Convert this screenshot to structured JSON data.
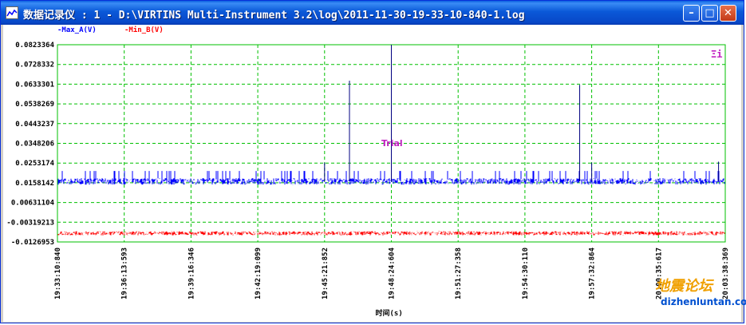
{
  "window": {
    "title": "数据记录仪 : 1 - D:\\VIRTINS Multi-Instrument 3.2\\log\\2011-11-30-19-33-10-840-1.log",
    "minimize_glyph": "–",
    "maximize_glyph": "□",
    "close_glyph": "✕"
  },
  "legend": {
    "a": "-Max_A(V)",
    "b": "-Min_B(V)"
  },
  "badge": "Ξi",
  "annotation": "Trial",
  "watermark": {
    "logo": "地震论坛",
    "url": "dizhenluntan.com"
  },
  "colors": {
    "series_a": "#0000ff",
    "series_b": "#ff0000",
    "grid": "#00c000",
    "frame": "#00c000",
    "title_bar": "#0a58d8"
  },
  "chart_data": {
    "type": "line",
    "title": "",
    "xlabel": "时间(s)",
    "ylabel": "",
    "y_ticks": [
      "0.0823364",
      "0.0728332",
      "0.0633301",
      "0.0538269",
      "0.0443237",
      "0.0348206",
      "0.0253174",
      "0.0158142",
      "0.00631104",
      "-0.00319213",
      "-0.0126953"
    ],
    "ylim": [
      -0.0126953,
      0.0823364
    ],
    "x_ticks": [
      "19:33:10:840",
      "19:36:13:593",
      "19:39:16:346",
      "19:42:19:099",
      "19:45:21:852",
      "19:48:24:604",
      "19:51:27:358",
      "19:54:30:110",
      "19:57:32:864",
      "20:00:35:617",
      "20:03:38:369"
    ],
    "grid": true,
    "series": [
      {
        "name": "Max_A(V)",
        "color": "#0000ff",
        "baseline": 0.0165,
        "noise_band": [
          0.0145,
          0.0215
        ],
        "spikes": [
          {
            "x": "19:45:21:852",
            "y": 0.0255
          },
          {
            "x": "19:46:30:000",
            "y": 0.065
          },
          {
            "x": "19:48:24:604",
            "y": 0.0823
          },
          {
            "x": "19:57:00:000",
            "y": 0.063
          },
          {
            "x": "19:57:32:864",
            "y": 0.0255
          },
          {
            "x": "20:03:20:000",
            "y": 0.026
          }
        ]
      },
      {
        "name": "Min_B(V)",
        "color": "#ff0000",
        "baseline": -0.0085,
        "noise_band": [
          -0.0112,
          -0.0068
        ]
      }
    ]
  }
}
